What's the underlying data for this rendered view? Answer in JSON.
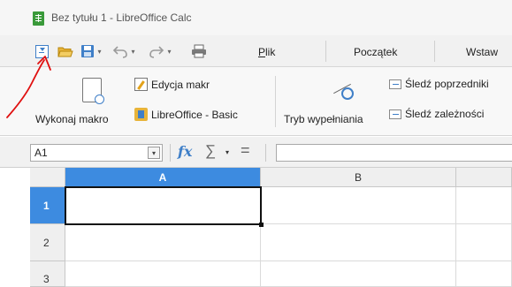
{
  "window": {
    "title": "Bez tytułu 1 - LibreOffice Calc"
  },
  "quick_access": {
    "menu_icon": "customize-toolbar-icon",
    "open_icon": "folder-open-icon",
    "save_icon": "floppy-save-icon",
    "undo_icon": "undo-arrow-icon",
    "redo_icon": "redo-arrow-icon",
    "print_icon": "printer-icon",
    "dropdown_glyph": "▾"
  },
  "tabs": {
    "file_prefix": "P",
    "file_rest": "lik",
    "home": "Początek",
    "insert": "Wstaw"
  },
  "ribbon": {
    "run_macro": "Wykonaj makro",
    "edit_macros": "Edycja makr",
    "basic": "LibreOffice - Basic",
    "fill_mode": "Tryb wypełniania",
    "trace_precedents": "Śledź poprzedniki",
    "trace_dependents": "Śledź zależności"
  },
  "formula_bar": {
    "name_box_value": "A1",
    "name_box_dropdown": "▾",
    "fx": "fx",
    "sigma": "∑",
    "sigma_dropdown": "▾",
    "equals": "=",
    "formula_value": ""
  },
  "sheet": {
    "columns": [
      "A",
      "B"
    ],
    "rows": [
      "1",
      "2",
      "3"
    ],
    "selected_cell": "A1"
  },
  "colors": {
    "selection_header": "#3d8be0",
    "accent_blue": "#3f7fc8",
    "annotation_red": "#e01010",
    "calc_green": "#3a9a3a"
  }
}
